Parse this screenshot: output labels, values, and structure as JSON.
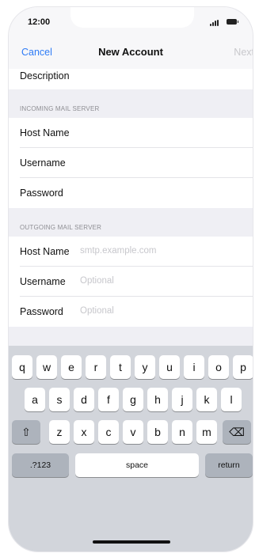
{
  "status_bar": {
    "time": "12:00"
  },
  "nav": {
    "cancel": "Cancel",
    "title": "New Account",
    "next": "Next"
  },
  "form": {
    "description_label": "Description",
    "incoming_header": "INCOMING MAIL SERVER",
    "incoming": [
      {
        "label": "Host Name",
        "value": ""
      },
      {
        "label": "Username",
        "value": ""
      },
      {
        "label": "Password",
        "value": ""
      }
    ],
    "outgoing_header": "OUTGOING MAIL SERVER",
    "outgoing": [
      {
        "label": "Host Name",
        "placeholder": "smtp.example.com"
      },
      {
        "label": "Username",
        "placeholder": "Optional"
      },
      {
        "label": "Password",
        "placeholder": "Optional"
      }
    ]
  },
  "keyboard": {
    "row1": [
      "q",
      "w",
      "e",
      "r",
      "t",
      "y",
      "u",
      "i",
      "o",
      "p"
    ],
    "row2": [
      "a",
      "s",
      "d",
      "f",
      "g",
      "h",
      "j",
      "k",
      "l"
    ],
    "row3": [
      "z",
      "x",
      "c",
      "v",
      "b",
      "n",
      "m"
    ],
    "shift_icon": "⇧",
    "delete_icon": "⌫",
    "numbers_key": ".?123",
    "space_key": "space",
    "return_key": "return"
  },
  "colors": {
    "accent": "#2f7cf6",
    "keyboard_bg": "#d2d5db",
    "group_bg": "#efeff4"
  }
}
